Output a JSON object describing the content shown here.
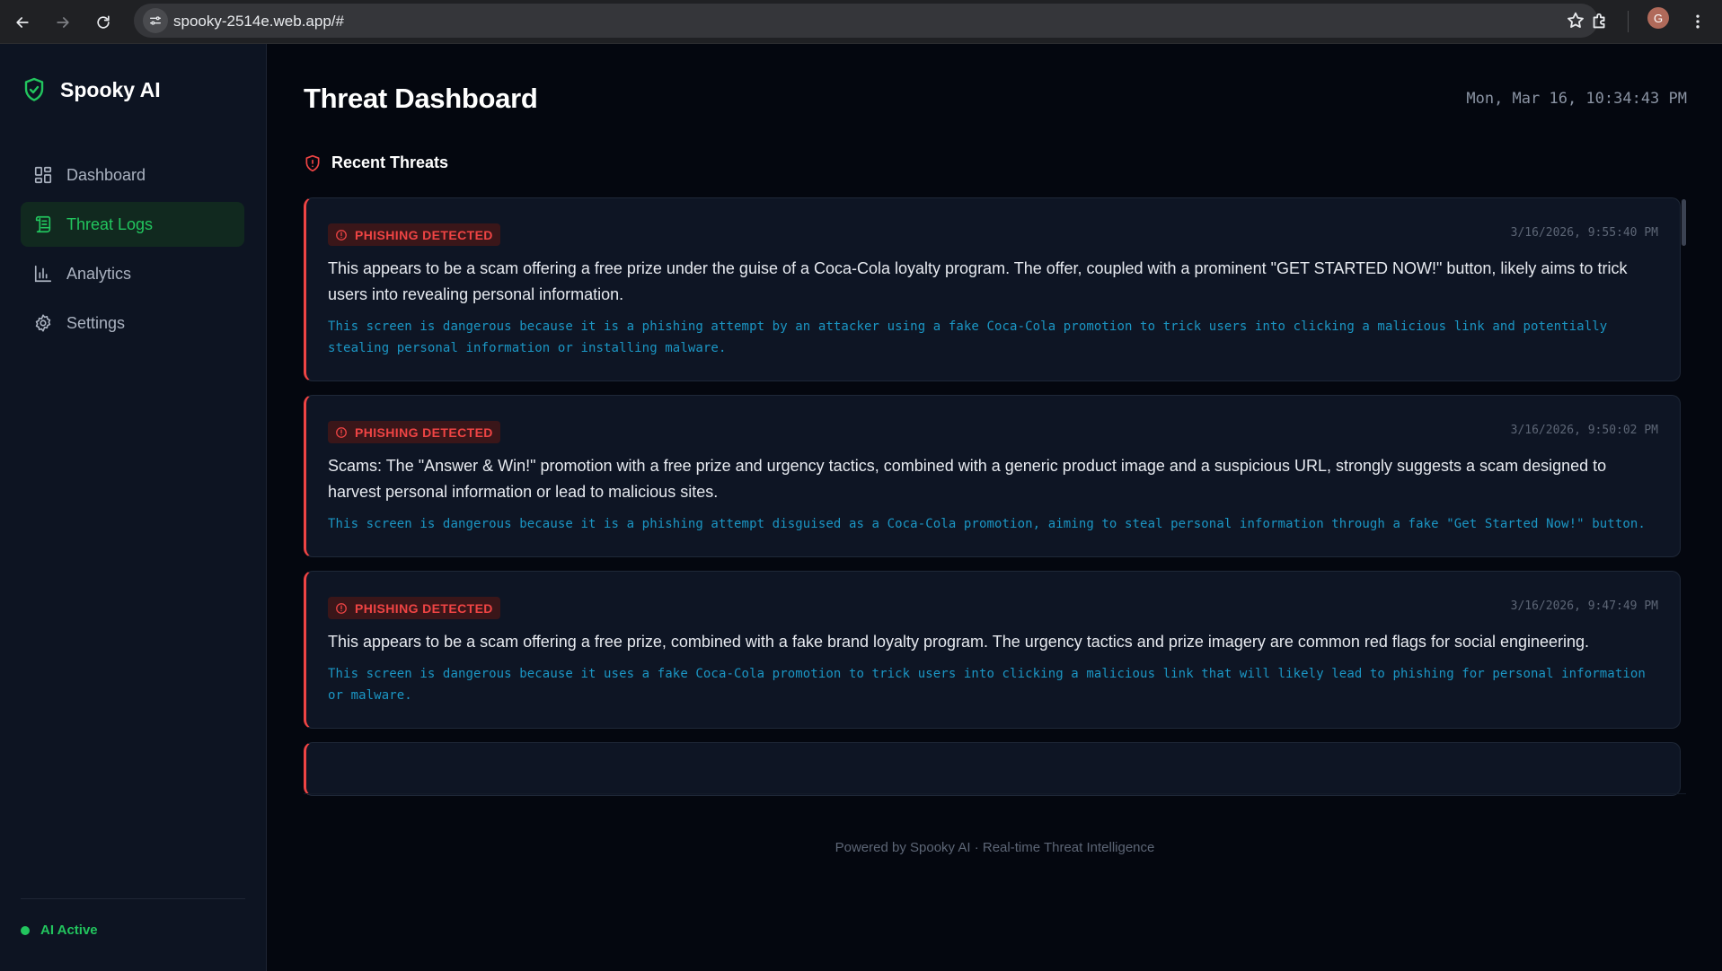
{
  "browser": {
    "url": "spooky-2514e.web.app/#",
    "profile_initial": "G"
  },
  "sidebar": {
    "brand": "Spooky AI",
    "items": [
      {
        "label": "Dashboard",
        "icon": "dashboard-grid-icon",
        "active": false
      },
      {
        "label": "Threat Logs",
        "icon": "scroll-log-icon",
        "active": true
      },
      {
        "label": "Analytics",
        "icon": "bar-chart-icon",
        "active": false
      },
      {
        "label": "Settings",
        "icon": "gear-icon",
        "active": false
      }
    ],
    "status": "AI Active"
  },
  "header": {
    "title": "Threat Dashboard",
    "datetime": "Mon, Mar 16, 10:34:43 PM"
  },
  "threats": {
    "section_title": "Recent Threats",
    "items": [
      {
        "badge": "PHISHING DETECTED",
        "time": "3/16/2026, 9:55:40 PM",
        "summary": "This appears to be a scam offering a free prize under the guise of a Coca-Cola loyalty program. The offer, coupled with a prominent \"GET STARTED NOW!\" button, likely aims to trick users into revealing personal information.",
        "reason": "This screen is dangerous because it is a phishing attempt by an attacker using a fake Coca-Cola promotion to trick users into clicking a malicious link and potentially stealing personal information or installing malware."
      },
      {
        "badge": "PHISHING DETECTED",
        "time": "3/16/2026, 9:50:02 PM",
        "summary": "Scams: The \"Answer & Win!\" promotion with a free prize and urgency tactics, combined with a generic product image and a suspicious URL, strongly suggests a scam designed to harvest personal information or lead to malicious sites.",
        "reason": "This screen is dangerous because it is a phishing attempt disguised as a Coca-Cola promotion, aiming to steal personal information through a fake \"Get Started Now!\" button."
      },
      {
        "badge": "PHISHING DETECTED",
        "time": "3/16/2026, 9:47:49 PM",
        "summary": "This appears to be a scam offering a free prize, combined with a fake brand loyalty program. The urgency tactics and prize imagery are common red flags for social engineering.",
        "reason": "This screen is dangerous because it uses a fake Coca-Cola promotion to trick users into clicking a malicious link that will likely lead to phishing for personal information or malware."
      }
    ]
  },
  "footer": {
    "text": "Powered by Spooky AI · Real-time Threat Intelligence"
  },
  "colors": {
    "accent_green": "#22c55e",
    "danger_red": "#ef4444",
    "reason_blue": "#1b96c4",
    "background": "#04070f",
    "sidebar_bg": "#0d1422"
  }
}
